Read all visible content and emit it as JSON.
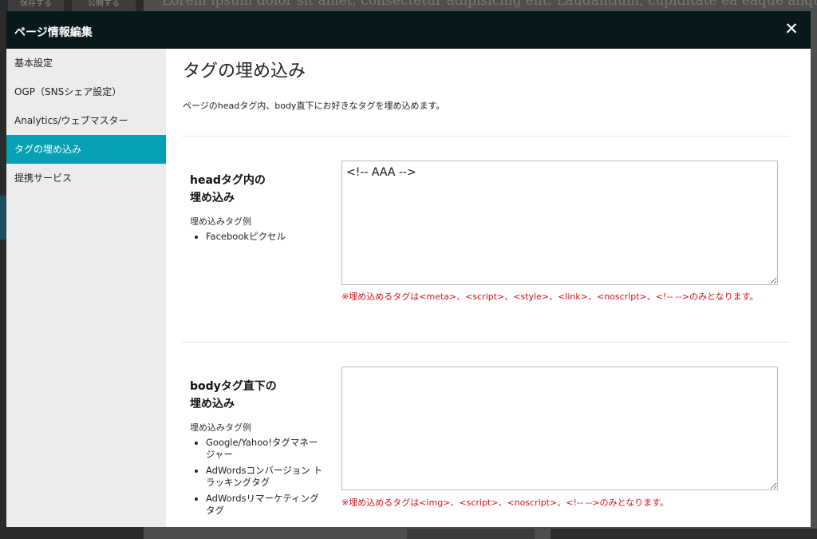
{
  "background": {
    "button1": "保存する",
    "button2": "公開する",
    "lorem": "Lorem ipsum dolor sit amet, consectetur adipisicing elit. Laudantium, cupiditate ea eaque aliquid"
  },
  "modal": {
    "title": "ページ情報編集",
    "close_label": "✕"
  },
  "sidebar": {
    "items": [
      {
        "label": "基本設定"
      },
      {
        "label": "OGP（SNSシェア設定）"
      },
      {
        "label": "Analytics/ウェブマスター"
      },
      {
        "label": "タグの埋め込み",
        "active": true
      },
      {
        "label": "提携サービス"
      }
    ]
  },
  "main": {
    "title": "タグの埋め込み",
    "description": "ページのheadタグ内、body直下にお好きなタグを埋め込めます。",
    "head_section": {
      "title_line1": "headタグ内の",
      "title_line2": "埋め込み",
      "examples_label": "埋め込みタグ例",
      "examples": [
        "Facebookピクセル"
      ],
      "textarea_value": "<!-- AAA -->",
      "note": "※埋め込めるタグは<meta>、<script>、<style>、<link>、<noscript>、<!-- -->のみとなります。"
    },
    "body_section": {
      "title_line1": "bodyタグ直下の",
      "title_line2": "埋め込み",
      "examples_label": "埋め込みタグ例",
      "examples": [
        "Google/Yahoo!タグマネージャー",
        "AdWordsコンバージョン トラッキングタグ",
        "AdWordsリマーケティングタグ"
      ],
      "textarea_value": "",
      "note": "※埋め込めるタグは<img>、<script>、<noscript>、<!-- -->のみとなります。"
    }
  },
  "colors": {
    "header_bg": "#08191c",
    "accent": "#05a0b3",
    "sidebar_bg": "#ececec",
    "note_red": "#d0141b"
  }
}
